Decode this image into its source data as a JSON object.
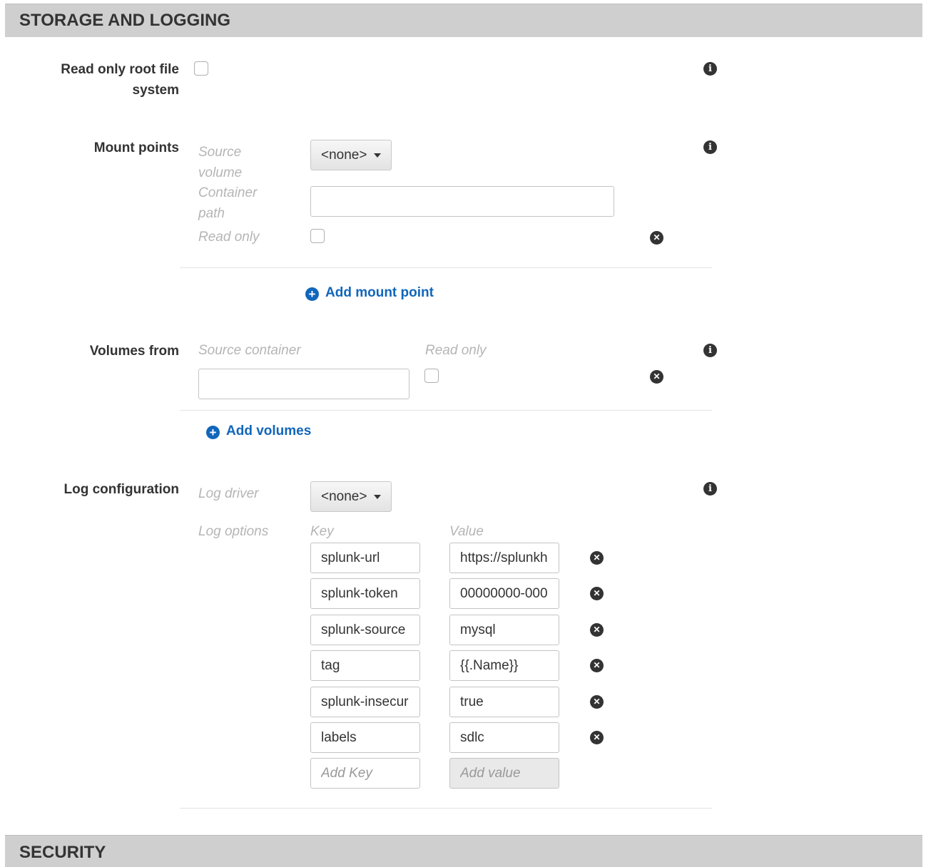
{
  "storage": {
    "title": "STORAGE AND LOGGING",
    "readonly_root": {
      "label_line1": "Read only root file",
      "label_line2": "system"
    },
    "mount_points": {
      "label": "Mount points",
      "source_volume_line1": "Source",
      "source_volume_line2": "volume",
      "source_volume_value": "<none>",
      "container_path_line1": "Container",
      "container_path_line2": "path",
      "read_only": "Read only",
      "add_label": "Add mount point"
    },
    "volumes_from": {
      "label": "Volumes from",
      "source_container": "Source container",
      "read_only": "Read only",
      "add_label": "Add volumes"
    },
    "log_config": {
      "label": "Log configuration",
      "driver_label": "Log driver",
      "driver_value": "<none>",
      "options_label": "Log options",
      "key_header": "Key",
      "value_header": "Value",
      "options": [
        {
          "key": "splunk-url",
          "value": "https://splunkh"
        },
        {
          "key": "splunk-token",
          "value": "00000000-000"
        },
        {
          "key": "splunk-source",
          "value": "mysql"
        },
        {
          "key": "tag",
          "value": "{{.Name}}"
        },
        {
          "key": "splunk-insecur",
          "value": "true"
        },
        {
          "key": "labels",
          "value": "sdlc"
        }
      ],
      "add_key_placeholder": "Add Key",
      "add_value_placeholder": "Add value"
    }
  },
  "security": {
    "title": "SECURITY"
  },
  "icons": {
    "info": "info-icon",
    "remove": "remove-icon",
    "add": "plus-circle-icon",
    "caret": "caret-down-icon"
  },
  "colors": {
    "header_bg": "#cfcfcf",
    "link": "#1166bb"
  }
}
